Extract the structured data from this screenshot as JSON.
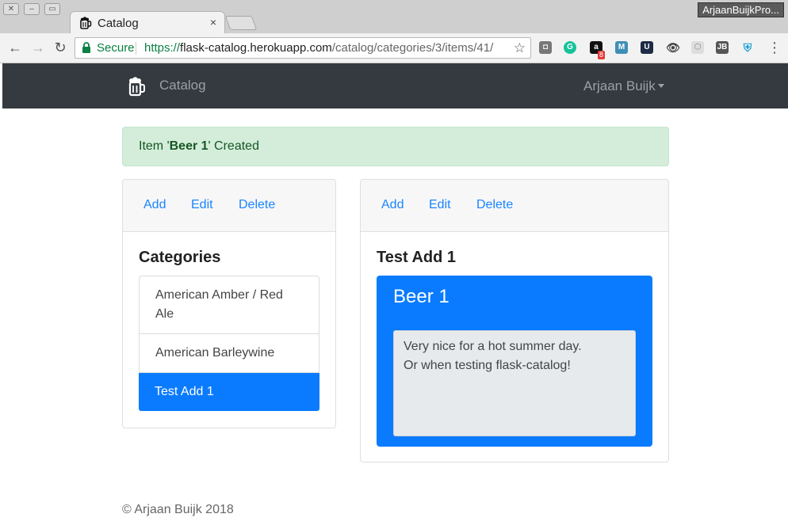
{
  "browser": {
    "tab_title": "Catalog",
    "tab_close": "×",
    "profile_name": "ArjaanBuijkPro...",
    "secure_label": "Secure",
    "url_scheme": "https://",
    "url_host": "flask-catalog.herokuapp.com",
    "url_path": "/catalog/categories/3/items/41/",
    "extension_badge": "8"
  },
  "navbar": {
    "brand": "Catalog",
    "user": "Arjaan Buijk"
  },
  "alert": {
    "prefix": "Item '",
    "item": "Beer 1",
    "suffix": "' Created"
  },
  "categories_card": {
    "actions": [
      "Add",
      "Edit",
      "Delete"
    ],
    "title": "Categories",
    "items": [
      {
        "label": "American Amber / Red Ale",
        "active": false
      },
      {
        "label": "American Barleywine",
        "active": false
      },
      {
        "label": "Test Add 1",
        "active": true
      }
    ]
  },
  "items_card": {
    "actions": [
      "Add",
      "Edit",
      "Delete"
    ],
    "title": "Test Add 1",
    "item_name": "Beer 1",
    "description_lines": [
      "Very nice for a hot summer day.",
      "Or when testing flask-catalog!"
    ]
  },
  "footer": {
    "text": "© Arjaan Buijk 2018"
  },
  "colors": {
    "primary": "#0a7bff",
    "navbar": "#343a40",
    "alert_bg": "#d4edda",
    "alert_text": "#155724"
  }
}
